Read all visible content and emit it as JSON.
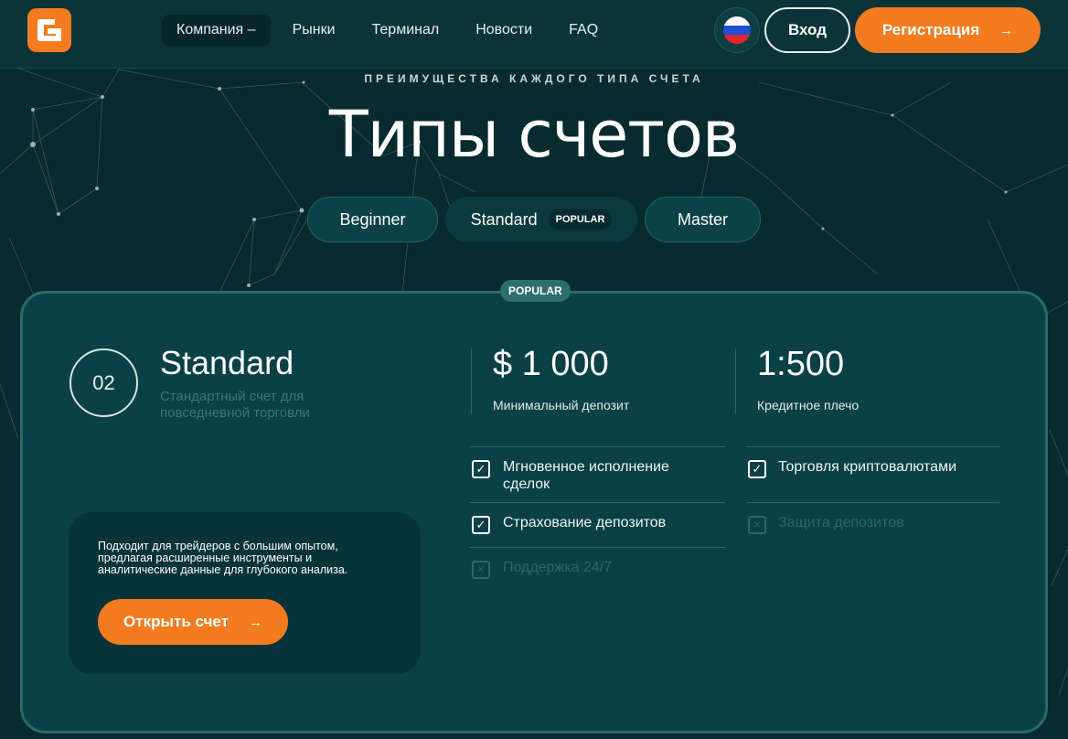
{
  "brand": {
    "accent": "#f47b20",
    "background": "#072b2f"
  },
  "header": {
    "logo_icon": "brand-logo-icon",
    "nav": [
      {
        "label": "Компания –"
      },
      {
        "label": "Рынки"
      },
      {
        "label": "Терминал"
      },
      {
        "label": "Новости"
      },
      {
        "label": "FAQ"
      }
    ],
    "language_icon": "russia-flag-icon",
    "login_label": "Вход",
    "register_label": "Регистрация",
    "register_arrow": "→"
  },
  "hero": {
    "eyebrow": "ПРЕИМУЩЕСТВА КАЖДОГО ТИПА СЧЕТА",
    "title": "Типы счетов"
  },
  "tabs": [
    {
      "label": "Beginner"
    },
    {
      "label": "Standard",
      "badge": "POPULAR"
    },
    {
      "label": "Master"
    }
  ],
  "card": {
    "badge": "POPULAR",
    "number": "02",
    "name": "Standard",
    "description": "Стандартный счет для повседневной торговли",
    "deposit_value": "$ 1 000",
    "deposit_label": "Минимальный депозит",
    "leverage_value": "1:500",
    "leverage_label": "Кредитное плечо",
    "features_left": [
      {
        "label": "Мгновенное исполнение сделок",
        "enabled": true
      },
      {
        "label": "Страхование депозитов",
        "enabled": true
      },
      {
        "label": "Поддержка 24/7",
        "enabled": false
      }
    ],
    "features_right": [
      {
        "label": "Торговля криптовалютами",
        "enabled": true
      },
      {
        "label": "Защита депозитов",
        "enabled": false
      }
    ],
    "info_text": "Подходит для трейдеров с большим опытом, предлагая расширенные инструменты и аналитические данные для глубокого анализа.",
    "open_button_label": "Открыть счет",
    "open_button_arrow": "→"
  }
}
